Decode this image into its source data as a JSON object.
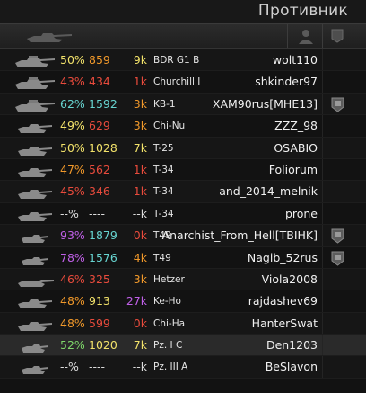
{
  "panel": {
    "title": "Противник"
  },
  "header": {
    "tank_column_icon": "tank-silhouette-icon",
    "player_column_icon": "player-silhouette-icon",
    "clan_column_icon": "clan-emblem-icon"
  },
  "colors": {
    "red": "#e84b3c",
    "orange": "#f0982a",
    "yellow": "#f2e26a",
    "green": "#7fd96b",
    "teal": "#67d4d0",
    "purple": "#c060e8",
    "white": "#dcdcdc"
  },
  "rows": [
    {
      "pct": "50%",
      "pct_color": "#f2e26a",
      "battles": "859",
      "battles_color": "#f0982a",
      "wn": "9k",
      "wn_color": "#f2e26a",
      "vehicle": "BDR G1 B",
      "player": "wolt110",
      "tank_icon": "heavy-tank-icon",
      "selected": false
    },
    {
      "pct": "43%",
      "pct_color": "#e84b3c",
      "battles": "434",
      "battles_color": "#e84b3c",
      "wn": "1k",
      "wn_color": "#e84b3c",
      "vehicle": "Churchill I",
      "player": "shkinder97",
      "tank_icon": "heavy-tank-icon",
      "selected": false
    },
    {
      "pct": "62%",
      "pct_color": "#67d4d0",
      "battles": "1592",
      "battles_color": "#67d4d0",
      "wn": "3k",
      "wn_color": "#f0982a",
      "vehicle": "KB-1",
      "player": "XAM90rus[MHE13]",
      "tank_icon": "heavy-tank-icon",
      "clan_badge": "clan-emblem-icon",
      "selected": false
    },
    {
      "pct": "49%",
      "pct_color": "#f2e26a",
      "battles": "629",
      "battles_color": "#e84b3c",
      "wn": "3k",
      "wn_color": "#f0982a",
      "vehicle": "Chi-Nu",
      "player": "ZZZ_98",
      "tank_icon": "medium-tank-icon",
      "selected": false
    },
    {
      "pct": "50%",
      "pct_color": "#f2e26a",
      "battles": "1028",
      "battles_color": "#f2e26a",
      "wn": "7k",
      "wn_color": "#f2e26a",
      "vehicle": "T-25",
      "player": "OSABIO",
      "tank_icon": "medium-tank-icon",
      "selected": false
    },
    {
      "pct": "47%",
      "pct_color": "#f0982a",
      "battles": "562",
      "battles_color": "#e84b3c",
      "wn": "1k",
      "wn_color": "#e84b3c",
      "vehicle": "T-34",
      "player": "Foliorum",
      "tank_icon": "medium-tank-icon",
      "selected": false
    },
    {
      "pct": "45%",
      "pct_color": "#e84b3c",
      "battles": "346",
      "battles_color": "#e84b3c",
      "wn": "1k",
      "wn_color": "#e84b3c",
      "vehicle": "T-34",
      "player": "and_2014_melnik",
      "tank_icon": "medium-tank-icon",
      "selected": false
    },
    {
      "pct": "--%",
      "pct_color": "#dcdcdc",
      "battles": "----",
      "battles_color": "#dcdcdc",
      "wn": "--k",
      "wn_color": "#dcdcdc",
      "vehicle": "T-34",
      "player": "prone",
      "tank_icon": "medium-tank-icon",
      "selected": false
    },
    {
      "pct": "93%",
      "pct_color": "#c060e8",
      "battles": "1879",
      "battles_color": "#67d4d0",
      "wn": "0k",
      "wn_color": "#e84b3c",
      "vehicle": "T49",
      "player": "Anarchist_From_Hell[TBIHK]",
      "tank_icon": "light-tank-icon",
      "clan_badge": "clan-emblem-icon",
      "selected": false
    },
    {
      "pct": "78%",
      "pct_color": "#c060e8",
      "battles": "1576",
      "battles_color": "#67d4d0",
      "wn": "4k",
      "wn_color": "#f0982a",
      "vehicle": "T49",
      "player": "Nagib_52rus",
      "tank_icon": "light-tank-icon",
      "clan_badge": "clan-emblem-icon",
      "selected": false
    },
    {
      "pct": "46%",
      "pct_color": "#e84b3c",
      "battles": "325",
      "battles_color": "#e84b3c",
      "wn": "3k",
      "wn_color": "#f0982a",
      "vehicle": "Hetzer",
      "player": "Viola2008",
      "tank_icon": "tank-destroyer-icon",
      "selected": false
    },
    {
      "pct": "48%",
      "pct_color": "#f0982a",
      "battles": "913",
      "battles_color": "#f2e26a",
      "wn": "27k",
      "wn_color": "#c060e8",
      "vehicle": "Ke-Ho",
      "player": "rajdashev69",
      "tank_icon": "medium-tank-icon",
      "selected": false
    },
    {
      "pct": "48%",
      "pct_color": "#f0982a",
      "battles": "599",
      "battles_color": "#e84b3c",
      "wn": "0k",
      "wn_color": "#e84b3c",
      "vehicle": "Chi-Ha",
      "player": "HanterSwat",
      "tank_icon": "medium-tank-icon",
      "selected": false
    },
    {
      "pct": "52%",
      "pct_color": "#7fd96b",
      "battles": "1020",
      "battles_color": "#f2e26a",
      "wn": "7k",
      "wn_color": "#f2e26a",
      "vehicle": "Pz. I C",
      "player": "Den1203",
      "tank_icon": "light-tank-icon",
      "selected": true
    },
    {
      "pct": "--%",
      "pct_color": "#dcdcdc",
      "battles": "----",
      "battles_color": "#dcdcdc",
      "wn": "--k",
      "wn_color": "#dcdcdc",
      "vehicle": "Pz. III A",
      "player": "BeSlavon",
      "tank_icon": "light-tank-icon",
      "selected": false
    }
  ]
}
